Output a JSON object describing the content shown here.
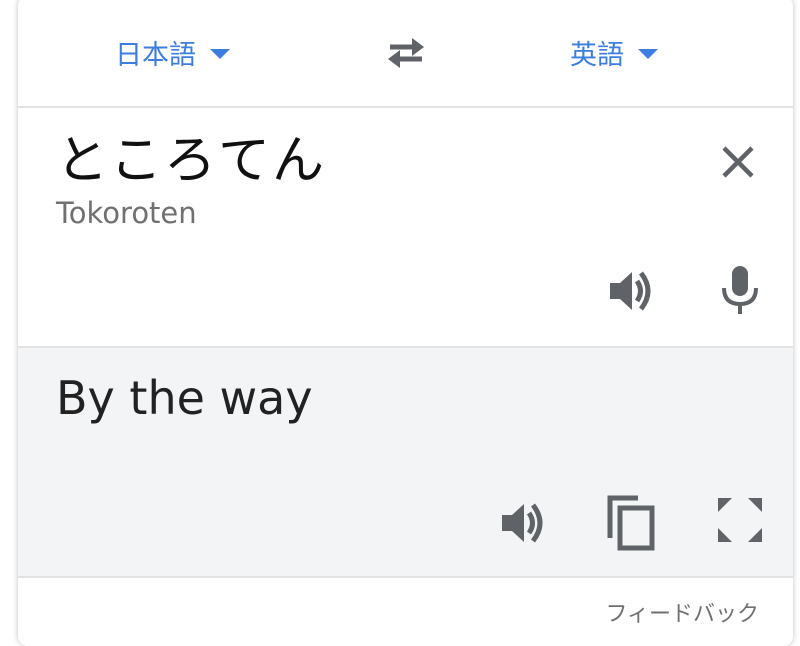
{
  "languages": {
    "source": "日本語",
    "target": "英語"
  },
  "input": {
    "text": "ところてん",
    "transliteration": "Tokoroten"
  },
  "output": {
    "text": "By the way"
  },
  "footer": {
    "feedback_label": "フィードバック"
  },
  "colors": {
    "accent": "#3d7de0",
    "icon": "#5f6368",
    "output_bg": "#f3f4f6"
  },
  "icons": [
    "chevron-down-icon",
    "swap-icon",
    "close-icon",
    "speaker-icon",
    "mic-icon",
    "copy-icon",
    "fullscreen-icon"
  ]
}
